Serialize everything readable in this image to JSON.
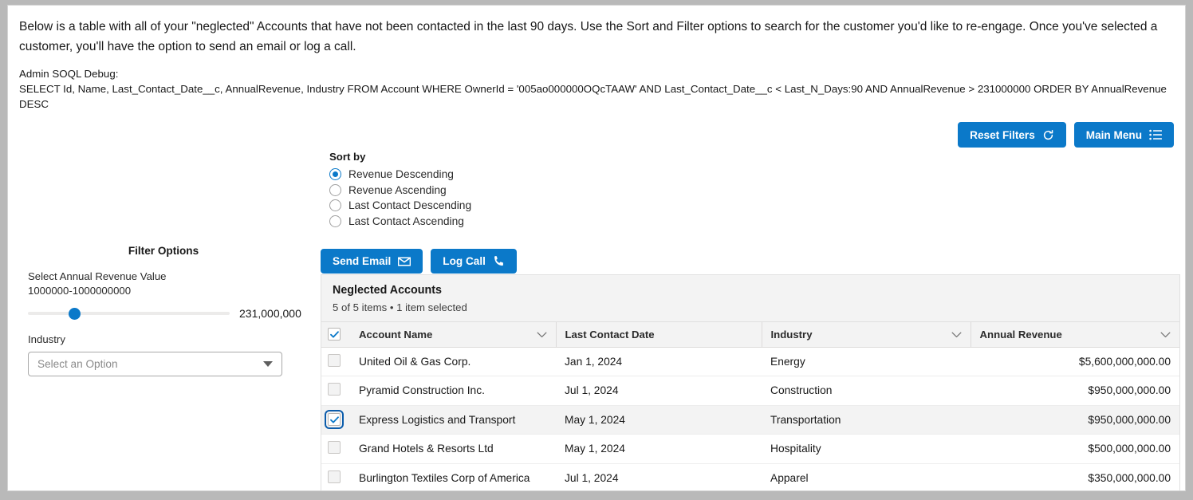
{
  "intro": {
    "paragraph": "Below is a table with all of your \"neglected\" Accounts that have not been contacted in the last 90 days. Use the Sort and Filter options to search for the customer you'd like to re-engage. Once you've selected a customer, you'll have the option to send an email or log a call.",
    "debug_label": "Admin SOQL Debug:",
    "debug_query": "SELECT Id, Name, Last_Contact_Date__c, AnnualRevenue, Industry FROM Account WHERE OwnerId = '005ao000000OQcTAAW' AND Last_Contact_Date__c < Last_N_Days:90 AND AnnualRevenue > 231000000 ORDER BY AnnualRevenue DESC"
  },
  "toolbar": {
    "reset_filters_label": "Reset Filters",
    "main_menu_label": "Main Menu",
    "accent_color": "#0b79c9"
  },
  "sort": {
    "title": "Sort by",
    "options": [
      {
        "label": "Revenue Descending",
        "selected": true
      },
      {
        "label": "Revenue Ascending",
        "selected": false
      },
      {
        "label": "Last Contact Descending",
        "selected": false
      },
      {
        "label": "Last Contact Ascending",
        "selected": false
      }
    ]
  },
  "filters": {
    "title": "Filter Options",
    "revenue_label": "Select Annual Revenue Value",
    "revenue_range": "1000000-1000000000",
    "revenue_value": "231,000,000",
    "slider_percent": 23,
    "industry_label": "Industry",
    "industry_placeholder": "Select an Option",
    "industry_value": ""
  },
  "actions": {
    "send_email_label": "Send Email",
    "log_call_label": "Log Call"
  },
  "table": {
    "title": "Neglected Accounts",
    "subtitle": "5 of 5 items • 1 item selected",
    "select_all_checked": true,
    "columns": [
      {
        "label": "Account Name",
        "sortable": true
      },
      {
        "label": "Last Contact Date",
        "sortable": false
      },
      {
        "label": "Industry",
        "sortable": true
      },
      {
        "label": "Annual Revenue",
        "sortable": true
      }
    ],
    "rows": [
      {
        "selected": false,
        "account_name": "United Oil & Gas Corp.",
        "last_contact_date": "Jan 1, 2024",
        "industry": "Energy",
        "annual_revenue": "$5,600,000,000.00"
      },
      {
        "selected": false,
        "account_name": "Pyramid Construction Inc.",
        "last_contact_date": "Jul 1, 2024",
        "industry": "Construction",
        "annual_revenue": "$950,000,000.00"
      },
      {
        "selected": true,
        "account_name": "Express Logistics and Transport",
        "last_contact_date": "May 1, 2024",
        "industry": "Transportation",
        "annual_revenue": "$950,000,000.00"
      },
      {
        "selected": false,
        "account_name": "Grand Hotels & Resorts Ltd",
        "last_contact_date": "May 1, 2024",
        "industry": "Hospitality",
        "annual_revenue": "$500,000,000.00"
      },
      {
        "selected": false,
        "account_name": "Burlington Textiles Corp of America",
        "last_contact_date": "Jul 1, 2024",
        "industry": "Apparel",
        "annual_revenue": "$350,000,000.00"
      }
    ]
  }
}
